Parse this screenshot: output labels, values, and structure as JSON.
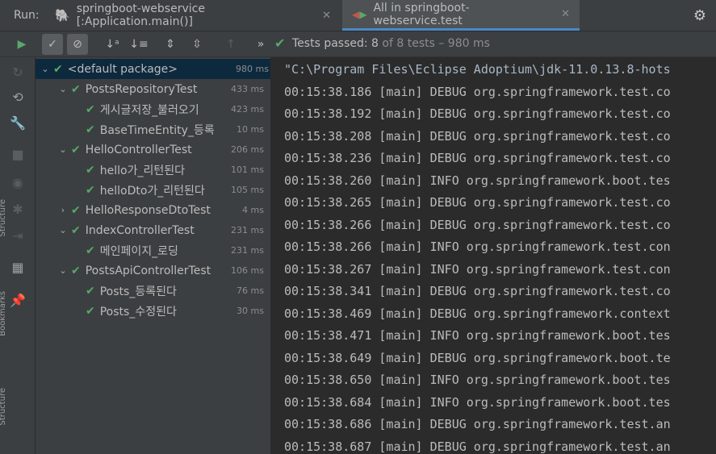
{
  "run_label": "Run:",
  "tabs": [
    {
      "label": "springboot-webservice [:Application.main()]",
      "close": "✕"
    },
    {
      "label": "All in springboot-webservice.test",
      "close": "✕"
    }
  ],
  "toolbar": {
    "status_prefix": "Tests passed: ",
    "passed": "8",
    "status_suffix": " of 8 tests – 980 ms"
  },
  "tree": [
    {
      "name": "<default package>",
      "time": "980 ms",
      "level": 0,
      "arrow": "⌄",
      "selected": true
    },
    {
      "name": "PostsRepositoryTest",
      "time": "433 ms",
      "level": 1,
      "arrow": "⌄"
    },
    {
      "name": "게시글저장_불러오기",
      "time": "423 ms",
      "level": 2,
      "arrow": ""
    },
    {
      "name": "BaseTimeEntity_등록",
      "time": "10 ms",
      "level": 2,
      "arrow": ""
    },
    {
      "name": "HelloControllerTest",
      "time": "206 ms",
      "level": 1,
      "arrow": "⌄"
    },
    {
      "name": "hello가_리턴된다",
      "time": "101 ms",
      "level": 2,
      "arrow": ""
    },
    {
      "name": "helloDto가_리턴된다",
      "time": "105 ms",
      "level": 2,
      "arrow": ""
    },
    {
      "name": "HelloResponseDtoTest",
      "time": "4 ms",
      "level": 1,
      "arrow": "›"
    },
    {
      "name": "IndexControllerTest",
      "time": "231 ms",
      "level": 1,
      "arrow": "⌄"
    },
    {
      "name": "메인페이지_로딩",
      "time": "231 ms",
      "level": 2,
      "arrow": ""
    },
    {
      "name": "PostsApiControllerTest",
      "time": "106 ms",
      "level": 1,
      "arrow": "⌄"
    },
    {
      "name": "Posts_등록된다",
      "time": "76 ms",
      "level": 2,
      "arrow": ""
    },
    {
      "name": "Posts_수정된다",
      "time": "30 ms",
      "level": 2,
      "arrow": ""
    }
  ],
  "console": [
    "\"C:\\Program Files\\Eclipse Adoptium\\jdk-11.0.13.8-hots",
    "00:15:38.186 [main] DEBUG org.springframework.test.co",
    "00:15:38.192 [main] DEBUG org.springframework.test.co",
    "00:15:38.208 [main] DEBUG org.springframework.test.co",
    "00:15:38.236 [main] DEBUG org.springframework.test.co",
    "00:15:38.260 [main] INFO org.springframework.boot.tes",
    "00:15:38.265 [main] DEBUG org.springframework.test.co",
    "00:15:38.266 [main] DEBUG org.springframework.test.co",
    "00:15:38.266 [main] INFO org.springframework.test.con",
    "00:15:38.267 [main] INFO org.springframework.test.con",
    "00:15:38.341 [main] DEBUG org.springframework.test.co",
    "00:15:38.469 [main] DEBUG org.springframework.context",
    "00:15:38.471 [main] INFO org.springframework.boot.tes",
    "00:15:38.649 [main] DEBUG org.springframework.boot.te",
    "00:15:38.650 [main] INFO org.springframework.boot.tes",
    "00:15:38.684 [main] INFO org.springframework.boot.tes",
    "00:15:38.686 [main] DEBUG org.springframework.test.an",
    "00:15:38.687 [main] DEBUG org.springframework.test.an"
  ],
  "side_labels": [
    "Structure",
    "Bookmarks",
    "Structure"
  ],
  "colors": {
    "accent": "#4a88c7",
    "pass": "#59a869",
    "selected": "#0d293e"
  }
}
